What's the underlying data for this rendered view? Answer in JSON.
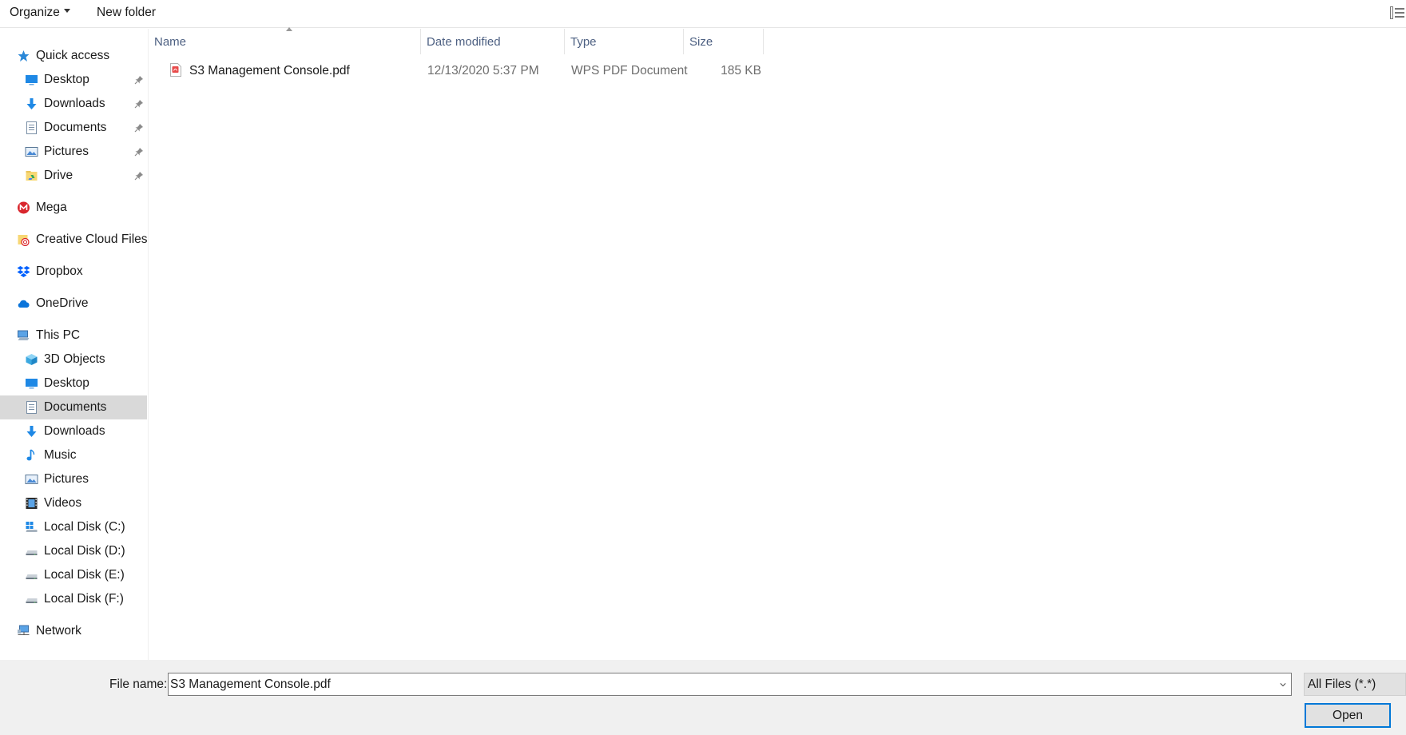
{
  "toolbar": {
    "organize_label": "Organize",
    "new_folder_label": "New folder"
  },
  "sidebar": {
    "quick_access": {
      "label": "Quick access",
      "items": [
        {
          "label": "Desktop",
          "icon": "desktop-icon"
        },
        {
          "label": "Downloads",
          "icon": "downloads-icon"
        },
        {
          "label": "Documents",
          "icon": "documents-icon"
        },
        {
          "label": "Pictures",
          "icon": "pictures-icon"
        },
        {
          "label": "Drive",
          "icon": "drive-folder-icon"
        }
      ]
    },
    "mega": "Mega",
    "creative_cloud": "Creative Cloud Files",
    "dropbox": "Dropbox",
    "onedrive": "OneDrive",
    "this_pc": {
      "label": "This PC",
      "items": [
        {
          "label": "3D Objects",
          "icon": "3d-objects-icon"
        },
        {
          "label": "Desktop",
          "icon": "desktop-icon"
        },
        {
          "label": "Documents",
          "icon": "documents-icon",
          "selected": true
        },
        {
          "label": "Downloads",
          "icon": "downloads-icon"
        },
        {
          "label": "Music",
          "icon": "music-icon"
        },
        {
          "label": "Pictures",
          "icon": "pictures-icon"
        },
        {
          "label": "Videos",
          "icon": "videos-icon"
        },
        {
          "label": "Local Disk (C:)",
          "icon": "windows-drive-icon"
        },
        {
          "label": "Local Disk (D:)",
          "icon": "drive-icon"
        },
        {
          "label": "Local Disk (E:)",
          "icon": "drive-icon"
        },
        {
          "label": "Local Disk (F:)",
          "icon": "drive-icon"
        }
      ]
    },
    "network": "Network"
  },
  "columns": {
    "name": "Name",
    "date_modified": "Date modified",
    "type": "Type",
    "size": "Size"
  },
  "files": [
    {
      "name": "S3 Management Console.pdf",
      "date_modified": "12/13/2020 5:37 PM",
      "type": "WPS PDF Document",
      "size": "185 KB"
    }
  ],
  "bottom": {
    "file_name_label": "File name:",
    "file_name_value": "S3 Management Console.pdf",
    "filter_label": "All Files (*.*)",
    "open_label": "Open"
  },
  "colors": {
    "selection_bg": "#d9d9d9",
    "header_text": "#4d6082",
    "accent_blue": "#0078d7"
  }
}
